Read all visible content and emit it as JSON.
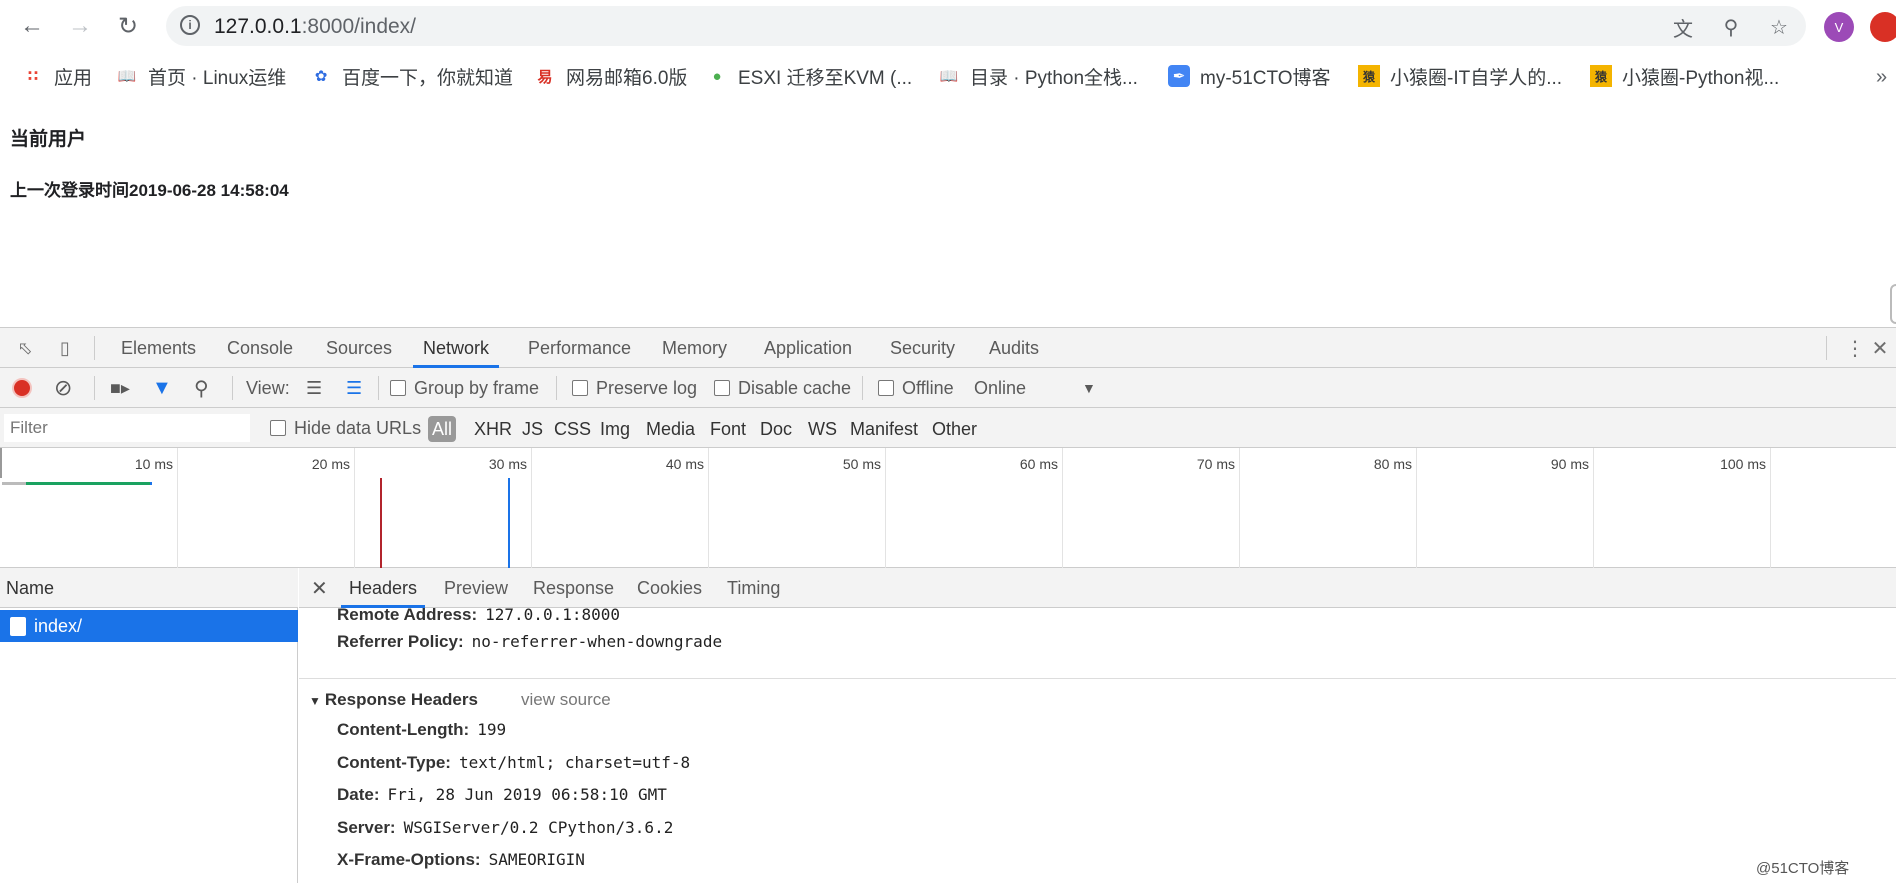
{
  "browser": {
    "url_host": "127.0.0.1",
    "url_rest": ":8000/index/",
    "avatar_letter": "V",
    "bookmarks": [
      {
        "label": "应用",
        "icon": "apps-grid-icon"
      },
      {
        "label": "首页 · Linux运维",
        "icon": "book-icon"
      },
      {
        "label": "百度一下，你就知道",
        "icon": "baidu-paw-icon"
      },
      {
        "label": "网易邮箱6.0版",
        "icon": "netease-icon"
      },
      {
        "label": "ESXI 迁移至KVM (...",
        "icon": "frog-icon"
      },
      {
        "label": "目录 · Python全栈...",
        "icon": "book-icon"
      },
      {
        "label": "my-51CTO博客",
        "icon": "feather-icon"
      },
      {
        "label": "小猿圈-IT自学人的...",
        "icon": "yuan-icon"
      },
      {
        "label": "小猿圈-Python视...",
        "icon": "yuan-icon"
      }
    ],
    "bookmarks_more": "»"
  },
  "page": {
    "title": "当前用户",
    "last_login": "上一次登录时间2019-06-28 14:58:04"
  },
  "devtools": {
    "tabs": [
      "Elements",
      "Console",
      "Sources",
      "Network",
      "Performance",
      "Memory",
      "Application",
      "Security",
      "Audits"
    ],
    "active_tab": "Network",
    "toolbar": {
      "view_label": "View:",
      "group_by_frame": "Group by frame",
      "preserve_log": "Preserve log",
      "disable_cache": "Disable cache",
      "offline": "Offline",
      "throttle": "Online"
    },
    "filter": {
      "placeholder": "Filter",
      "hide_data_urls": "Hide data URLs",
      "types": [
        "All",
        "XHR",
        "JS",
        "CSS",
        "Img",
        "Media",
        "Font",
        "Doc",
        "WS",
        "Manifest",
        "Other"
      ],
      "active_type": "All"
    },
    "timeline": {
      "ticks": [
        "10 ms",
        "20 ms",
        "30 ms",
        "40 ms",
        "50 ms",
        "60 ms",
        "70 ms",
        "80 ms",
        "90 ms",
        "100 ms"
      ]
    },
    "requests": {
      "name_header": "Name",
      "items": [
        "index/"
      ]
    },
    "detail": {
      "tabs": [
        "Headers",
        "Preview",
        "Response",
        "Cookies",
        "Timing"
      ],
      "active_tab": "Headers",
      "general": [
        {
          "key": "Remote Address:",
          "value": "127.0.0.1:8000"
        },
        {
          "key": "Referrer Policy:",
          "value": "no-referrer-when-downgrade"
        }
      ],
      "response_section": "Response Headers",
      "view_source": "view source",
      "response_headers": [
        {
          "key": "Content-Length:",
          "value": "199"
        },
        {
          "key": "Content-Type:",
          "value": "text/html; charset=utf-8"
        },
        {
          "key": "Date:",
          "value": "Fri, 28 Jun 2019 06:58:10 GMT"
        },
        {
          "key": "Server:",
          "value": "WSGIServer/0.2 CPython/3.6.2"
        },
        {
          "key": "X-Frame-Options:",
          "value": "SAMEORIGIN"
        }
      ]
    }
  },
  "watermark": "@51CTO博客"
}
